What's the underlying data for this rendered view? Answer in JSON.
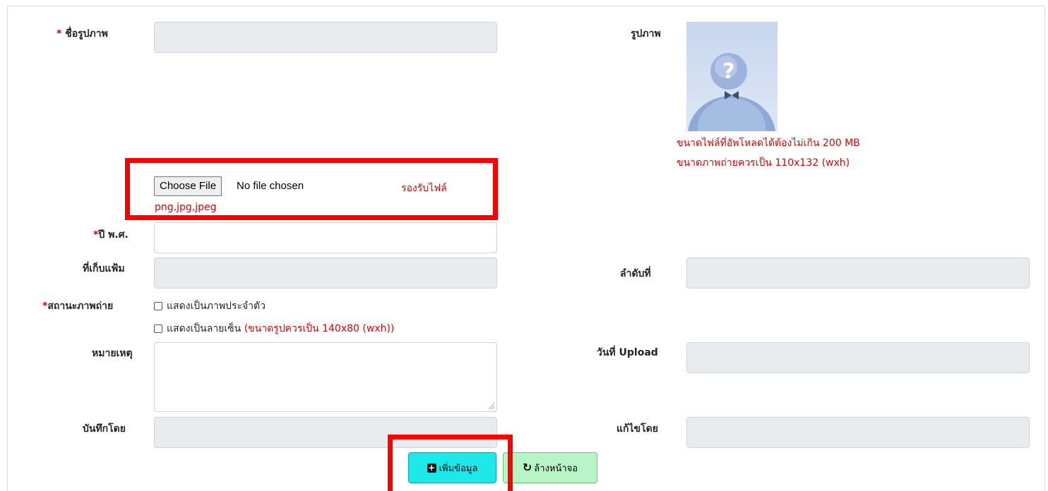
{
  "form": {
    "image_name": {
      "required": "*",
      "label": "ชื่อรูปภาพ",
      "value": ""
    },
    "image": {
      "label": "รูปภาพ",
      "size_note": "ขนาดไฟล์ที่อัพโหลดได้ต้องไม่เกิน 200 MB",
      "dimension_note": "ขนาดภาพถ่ายควรเป็น 110x132 (wxh)"
    },
    "file": {
      "button_label": "Choose File",
      "status": "No file chosen",
      "support_label": "รองรับไฟล์",
      "support_types": "png,jpg,jpeg"
    },
    "year": {
      "required": "*",
      "label": "ปี พ.ศ.",
      "value": ""
    },
    "folder": {
      "label": "ที่เก็บแฟ้ม",
      "value": ""
    },
    "order": {
      "label": "ลำดับที่",
      "value": ""
    },
    "photo_status": {
      "required": "*",
      "label": "สถานะภาพถ่าย",
      "option_profile": "แสดงเป็นภาพประจำตัว",
      "option_signature": "แสดงเป็นลายเซ็น",
      "signature_note": "(ขนาดรูปควรเป็น 140x80 (wxh))"
    },
    "note": {
      "label": "หมายเหตุ",
      "value": ""
    },
    "upload_date": {
      "label": "วันที่ Upload",
      "value": ""
    },
    "saved_by": {
      "label": "บันทึกโดย",
      "value": ""
    },
    "edited_by": {
      "label": "แก้ไขโดย",
      "value": ""
    }
  },
  "actions": {
    "add_label": "เพิ่มข้อมูล",
    "clear_label": "ล้างหน้าจอ"
  },
  "icons": {
    "add": "plus-square-icon",
    "clear": "refresh-icon",
    "avatar": "unknown-person-icon"
  },
  "colors": {
    "required": "#e00000",
    "note_text": "#e00000",
    "highlight_box": "#ff0000",
    "add_button": "#1de9e9",
    "clear_button": "#b8f5c6"
  }
}
